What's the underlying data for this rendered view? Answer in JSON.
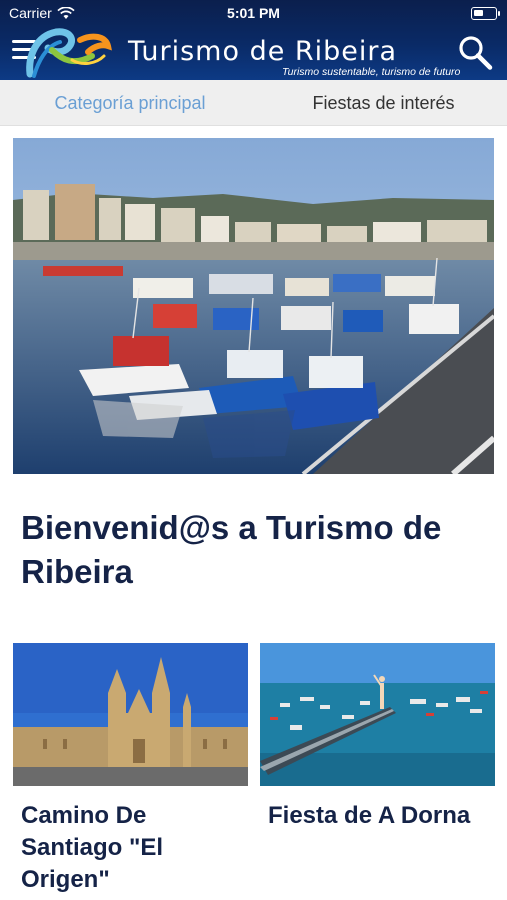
{
  "status_bar": {
    "carrier": "Carrier",
    "time": "5:01 PM"
  },
  "header": {
    "title": "Turismo de Ribeira",
    "subtitle": "Turismo sustentable, turismo de futuro",
    "menu_icon": "hamburger-menu-icon",
    "search_icon": "search-icon",
    "background_color": "#0a2a66"
  },
  "tabs": [
    {
      "label": "Categoría principal",
      "active": true
    },
    {
      "label": "Fiestas de interés",
      "active": false
    }
  ],
  "main": {
    "hero_image": "harbor-boats-photo",
    "headline": "Bienvenid@s a Turismo de Ribeira",
    "cards": [
      {
        "title": "Camino De Santiago \"El Origen\"",
        "image": "cathedral-photo"
      },
      {
        "title": "Fiesta de A Dorna",
        "image": "festival-sea-photo"
      }
    ]
  },
  "colors": {
    "tab_active": "#6a9fd4",
    "heading": "#152347"
  }
}
